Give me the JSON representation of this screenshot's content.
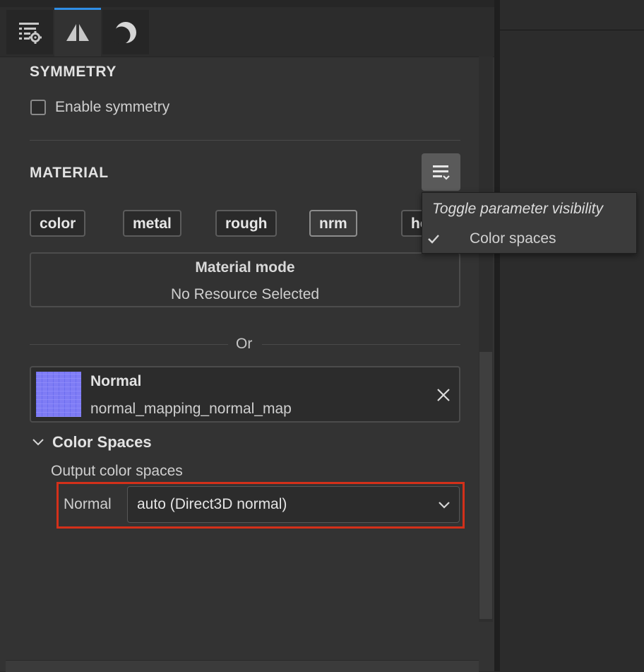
{
  "tabs": [
    {
      "name": "settings-list-icon",
      "active": false
    },
    {
      "name": "symmetry-icon",
      "active": true
    },
    {
      "name": "moon-icon",
      "active": false
    }
  ],
  "symmetry": {
    "title": "SYMMETRY",
    "enable_label": "Enable symmetry",
    "enabled": false
  },
  "material": {
    "title": "MATERIAL",
    "chips": [
      {
        "label": "color",
        "selected": false
      },
      {
        "label": "metal",
        "selected": false
      },
      {
        "label": "rough",
        "selected": false
      },
      {
        "label": "nrm",
        "selected": true
      },
      {
        "label": "height",
        "selected": false
      }
    ],
    "mode_title": "Material mode",
    "mode_subtitle": "No Resource Selected",
    "or_label": "Or",
    "resource": {
      "title": "Normal",
      "name": "normal_mapping_normal_map"
    }
  },
  "color_spaces": {
    "title": "Color Spaces",
    "expanded": true,
    "output_label": "Output color spaces",
    "row_label": "Normal",
    "selected_value": "auto (Direct3D normal)"
  },
  "popup": {
    "title": "Toggle parameter visibility",
    "items": [
      {
        "label": "Color spaces",
        "checked": true
      }
    ]
  },
  "colors": {
    "accent": "#2f8ee6",
    "highlight_border": "#d3301a"
  }
}
